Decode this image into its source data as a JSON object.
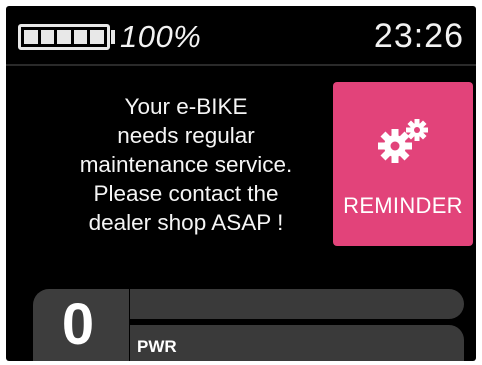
{
  "status_bar": {
    "battery_percent_label": "100%",
    "battery_level": 1.0,
    "clock": "23:26"
  },
  "message": {
    "text": "Your e-BIKE\nneeds regular\nmaintenance service.\nPlease contact the\ndealer shop ASAP !"
  },
  "reminder": {
    "label": "REMINDER",
    "icon": "gears-icon",
    "color": "#e2437a"
  },
  "power": {
    "value": "0",
    "mode_label": "PWR",
    "level": 0
  }
}
